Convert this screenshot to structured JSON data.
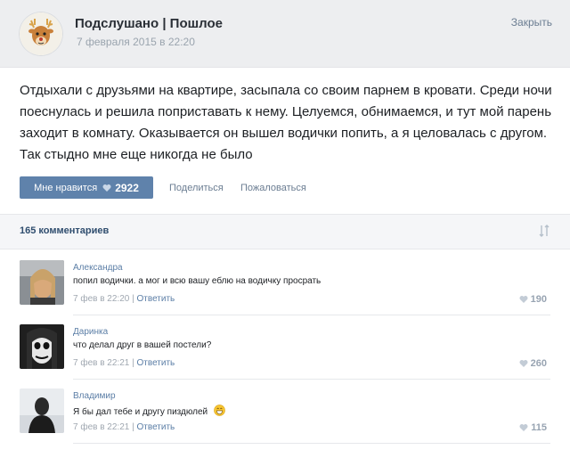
{
  "header": {
    "title": "Подслушано | Пошлое",
    "date": "7 февраля 2015 в 22:20",
    "close_label": "Закрыть"
  },
  "post": {
    "text": "Отдыхали с друзьями на квартире, засыпала со своим парнем в кровати. Среди ночи поеснулась и решила поприставать к нему. Целуемся, обнимаемся, и тут мой парень заходит в комнату. Оказывается он вышел водички попить, а я целовалась с другом. Так стыдно мне еще никогда не было",
    "like_label": "Мне нравится",
    "like_count": "2922",
    "share_label": "Поделиться",
    "complain_label": "Пожаловаться"
  },
  "comments": {
    "count_label": "165 комментариев",
    "items": [
      {
        "name": "Александра",
        "text": "попил водички. а мог и всю вашу еблю на водичку просрать",
        "time": "7 фев в 22:20",
        "reply_label": "Ответить",
        "likes": "190"
      },
      {
        "name": "Даринка",
        "text": "что делал друг в вашей постели?",
        "time": "7 фев в 22:21",
        "reply_label": "Ответить",
        "likes": "260"
      },
      {
        "name": "Владимир",
        "text": "Я бы дал тебе и другу пиздюлей",
        "time": "7 фев в 22:21",
        "reply_label": "Ответить",
        "likes": "115"
      }
    ]
  },
  "colors": {
    "accent": "#5f82ab",
    "link": "#5b7ea6",
    "header_bg": "#edeef0"
  }
}
